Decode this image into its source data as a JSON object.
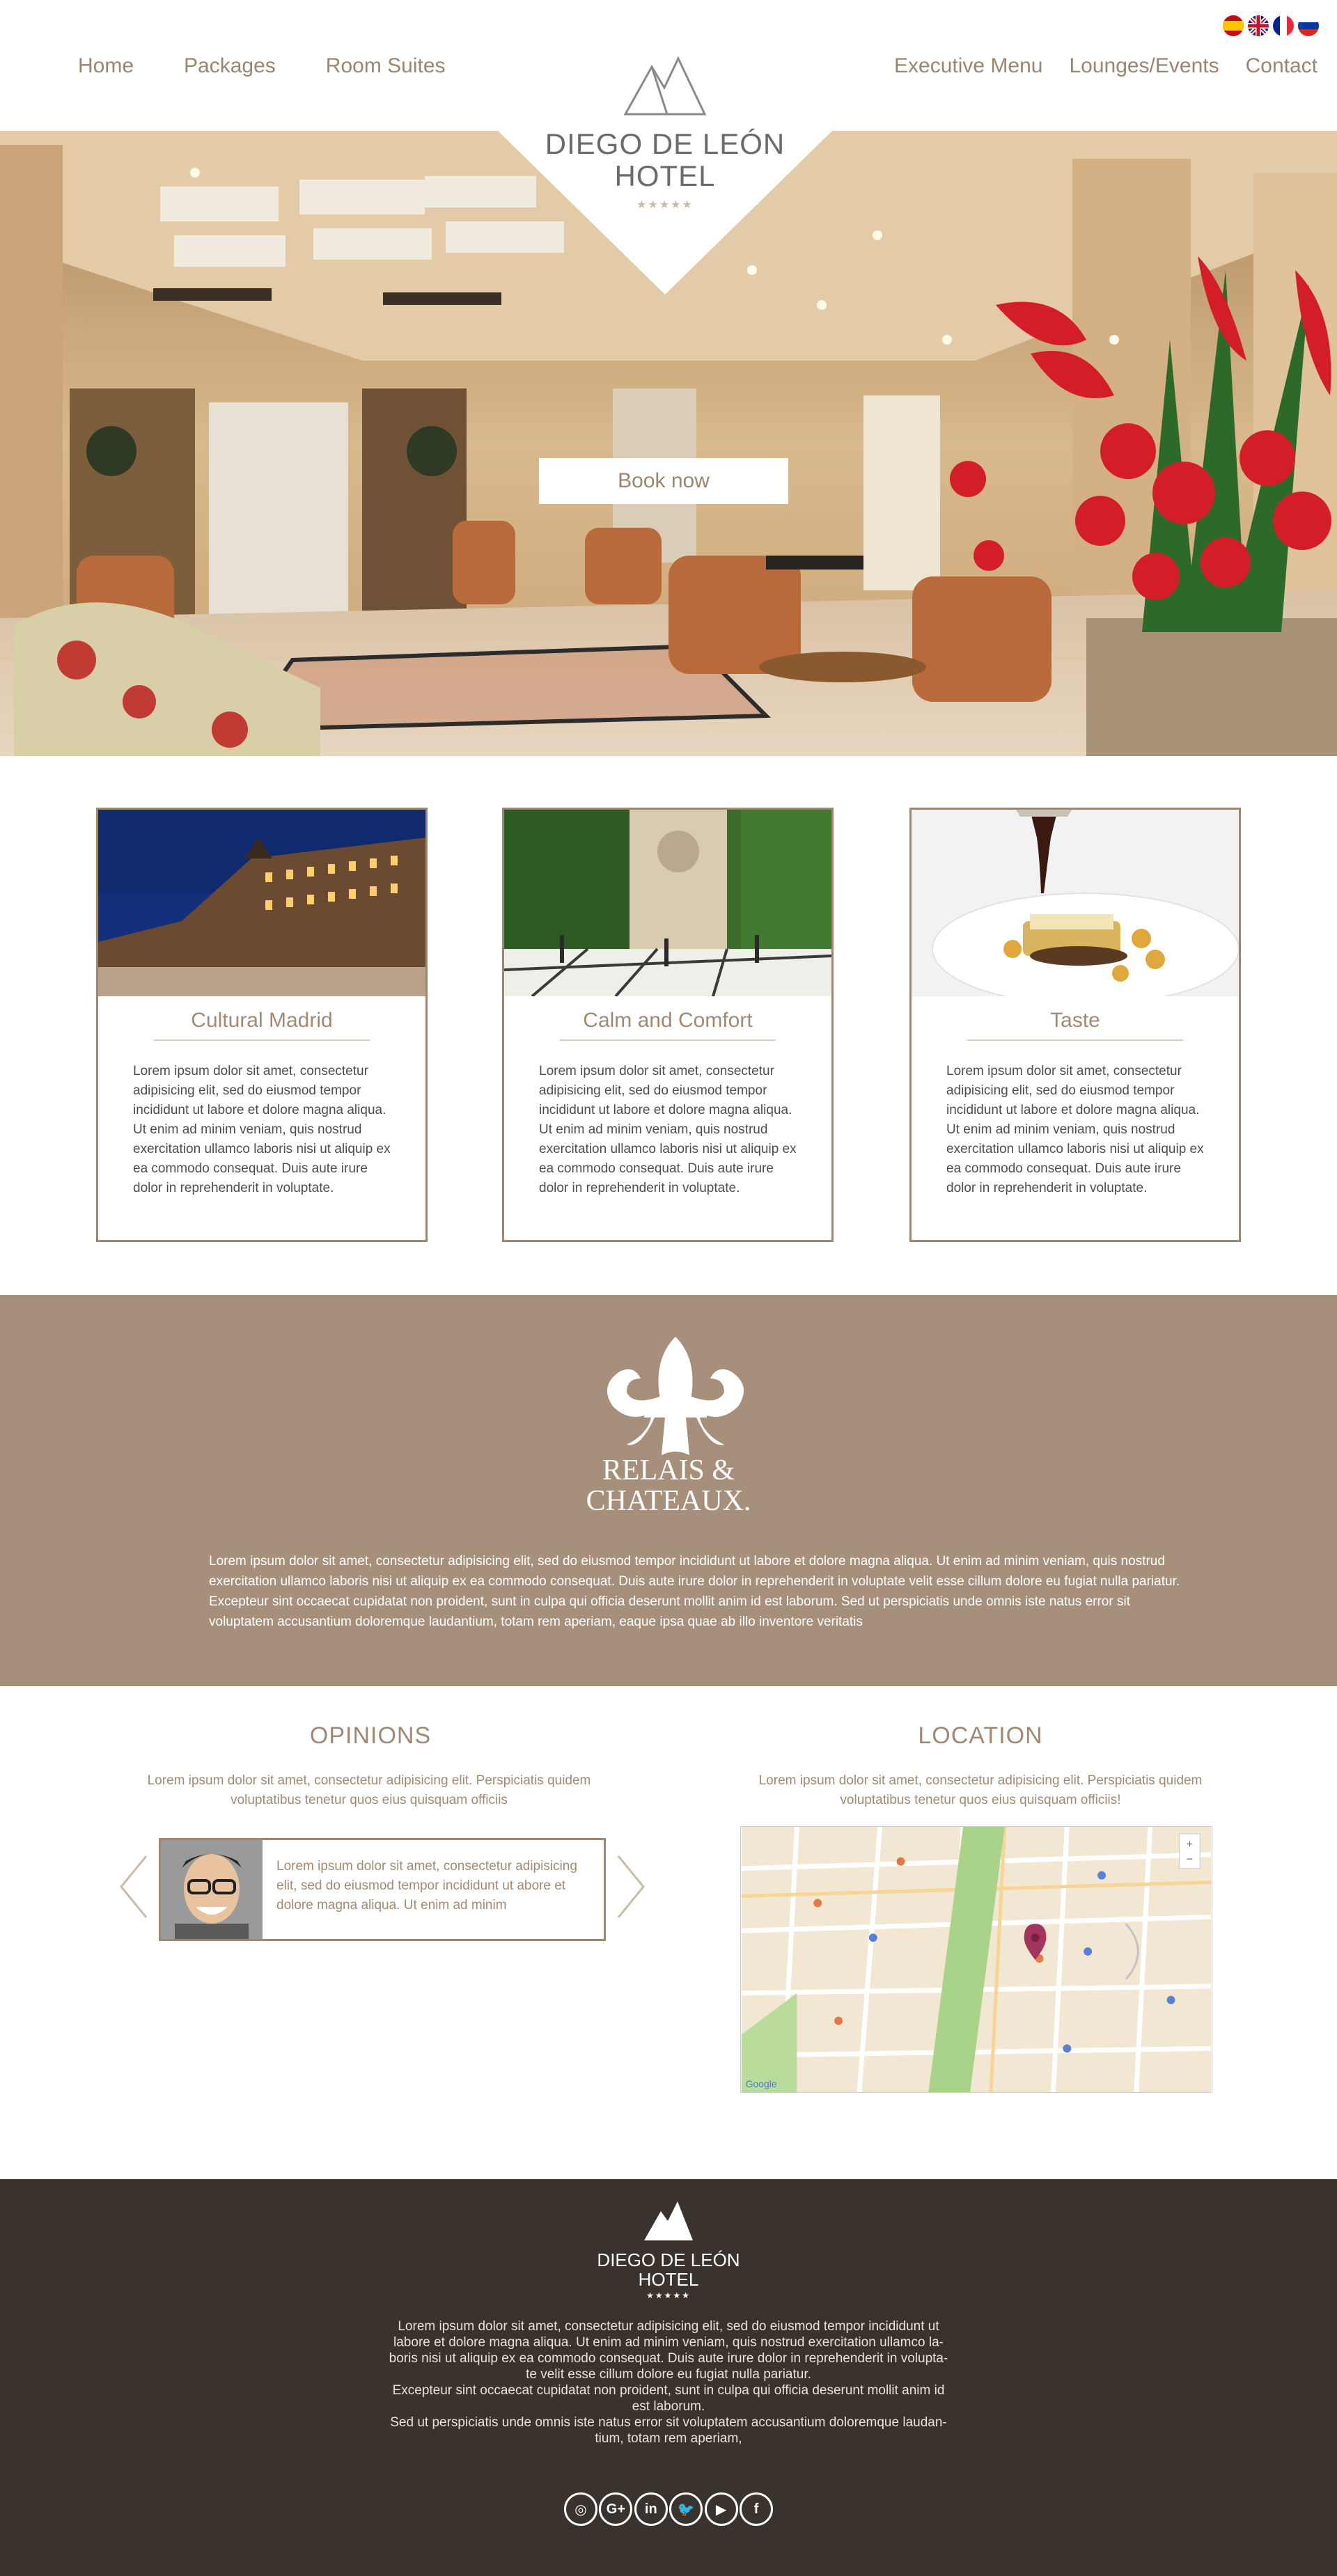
{
  "header": {
    "nav_left": [
      "Home",
      "Packages",
      "Room Suites"
    ],
    "nav_right": [
      "Executive Menu",
      "Lounges/Events",
      "Contact"
    ],
    "languages": [
      "es-flag-icon",
      "uk-flag-icon",
      "fr-flag-icon",
      "ru-flag-icon"
    ]
  },
  "logo": {
    "line1": "DIEGO DE LEÓN",
    "line2": "HOTEL",
    "stars": "★★★★★"
  },
  "hero": {
    "book_button": "Book now"
  },
  "cards": [
    {
      "title": "Cultural Madrid",
      "text": "Lorem ipsum dolor sit amet, consectetur adipisicing elit, sed do eiusmod tempor incididunt ut labore et dolore magna aliqua. Ut enim ad minim veniam, quis nostrud exercitation ullamco laboris nisi ut aliquip ex ea commodo consequat. Duis aute irure dolor in reprehenderit in voluptate."
    },
    {
      "title": "Calm and Comfort",
      "text": "Lorem ipsum dolor sit amet, consectetur adipisicing elit, sed do eiusmod tempor incididunt ut labore et dolore magna aliqua. Ut enim ad minim veniam, quis nostrud exercitation ullamco laboris nisi ut aliquip ex ea commodo consequat. Duis aute irure dolor in reprehenderit in voluptate."
    },
    {
      "title": "Taste",
      "text": "Lorem ipsum dolor sit amet, consectetur adipisicing elit, sed do eiusmod tempor incididunt ut labore et dolore magna aliqua. Ut enim ad minim veniam, quis nostrud exercitation ullamco laboris nisi ut aliquip ex ea commodo consequat. Duis aute irure dolor in reprehenderit in voluptate."
    }
  ],
  "relais": {
    "name_line1": "RELAIS &",
    "name_line2": "CHATEAUX.",
    "text": "Lorem ipsum dolor sit amet, consectetur adipisicing elit, sed do eiusmod tempor incididunt ut labore et dolore magna aliqua. Ut enim ad minim veniam, quis nostrud exercitation ullamco laboris nisi ut aliquip ex ea commodo consequat. Duis aute irure dolor in reprehenderit in voluptate velit esse cillum dolore eu fugiat nulla pariatur. Excepteur sint occaecat cupidatat non proident, sunt in culpa qui officia deserunt mollit anim id est laborum. Sed ut perspiciatis unde omnis iste natus error sit voluptatem accusantium doloremque laudantium, totam rem aperiam, eaque ipsa quae ab illo inventore veritatis"
  },
  "opinions": {
    "title": "OPINIONS",
    "subtitle": "Lorem ipsum dolor sit amet, consectetur adipisicing elit. Perspiciatis quidem voluptatibus tenetur quos eius quisquam officiis",
    "testimonial": "Lorem ipsum dolor sit amet, consectetur adipisicing elit, sed do eiusmod tempor incididunt ut abore et dolore magna aliqua. Ut enim ad minim"
  },
  "location": {
    "title": "LOCATION",
    "subtitle": "Lorem ipsum dolor sit amet, consectetur adipisicing elit. Perspiciatis quidem voluptatibus tenetur quos eius quisquam officiis!",
    "map_credit": "Google"
  },
  "footer": {
    "name_line1": "DIEGO DE LEÓN",
    "name_line2": "HOTEL",
    "stars": "★★★★★",
    "text_lines": [
      "Lorem ipsum dolor sit amet, consectetur adipisicing elit, sed do eiusmod tempor incididunt ut",
      "labore et dolore magna aliqua. Ut enim ad minim veniam, quis nostrud exercitation ullamco la-",
      "boris nisi ut aliquip ex ea commodo consequat. Duis aute irure dolor in reprehenderit in volupta-",
      "te velit esse cillum dolore eu fugiat nulla pariatur.",
      "Excepteur sint occaecat cupidatat non proident, sunt in culpa qui officia deserunt mollit anim id",
      "est laborum.",
      "Sed ut perspiciatis unde omnis iste natus error sit voluptatem accusantium doloremque laudan-",
      "tium, totam rem aperiam,"
    ],
    "socials": [
      {
        "icon": "instagram-icon",
        "glyph": "◎"
      },
      {
        "icon": "google-plus-icon",
        "glyph": "G+"
      },
      {
        "icon": "linkedin-icon",
        "glyph": "in"
      },
      {
        "icon": "twitter-icon",
        "glyph": "🐦"
      },
      {
        "icon": "youtube-icon",
        "glyph": "▶"
      },
      {
        "icon": "facebook-icon",
        "glyph": "f"
      }
    ]
  },
  "colors": {
    "accent": "#a08a75",
    "band": "#a68f7b",
    "footer": "#3a322c",
    "card_border": "#9b8772"
  }
}
